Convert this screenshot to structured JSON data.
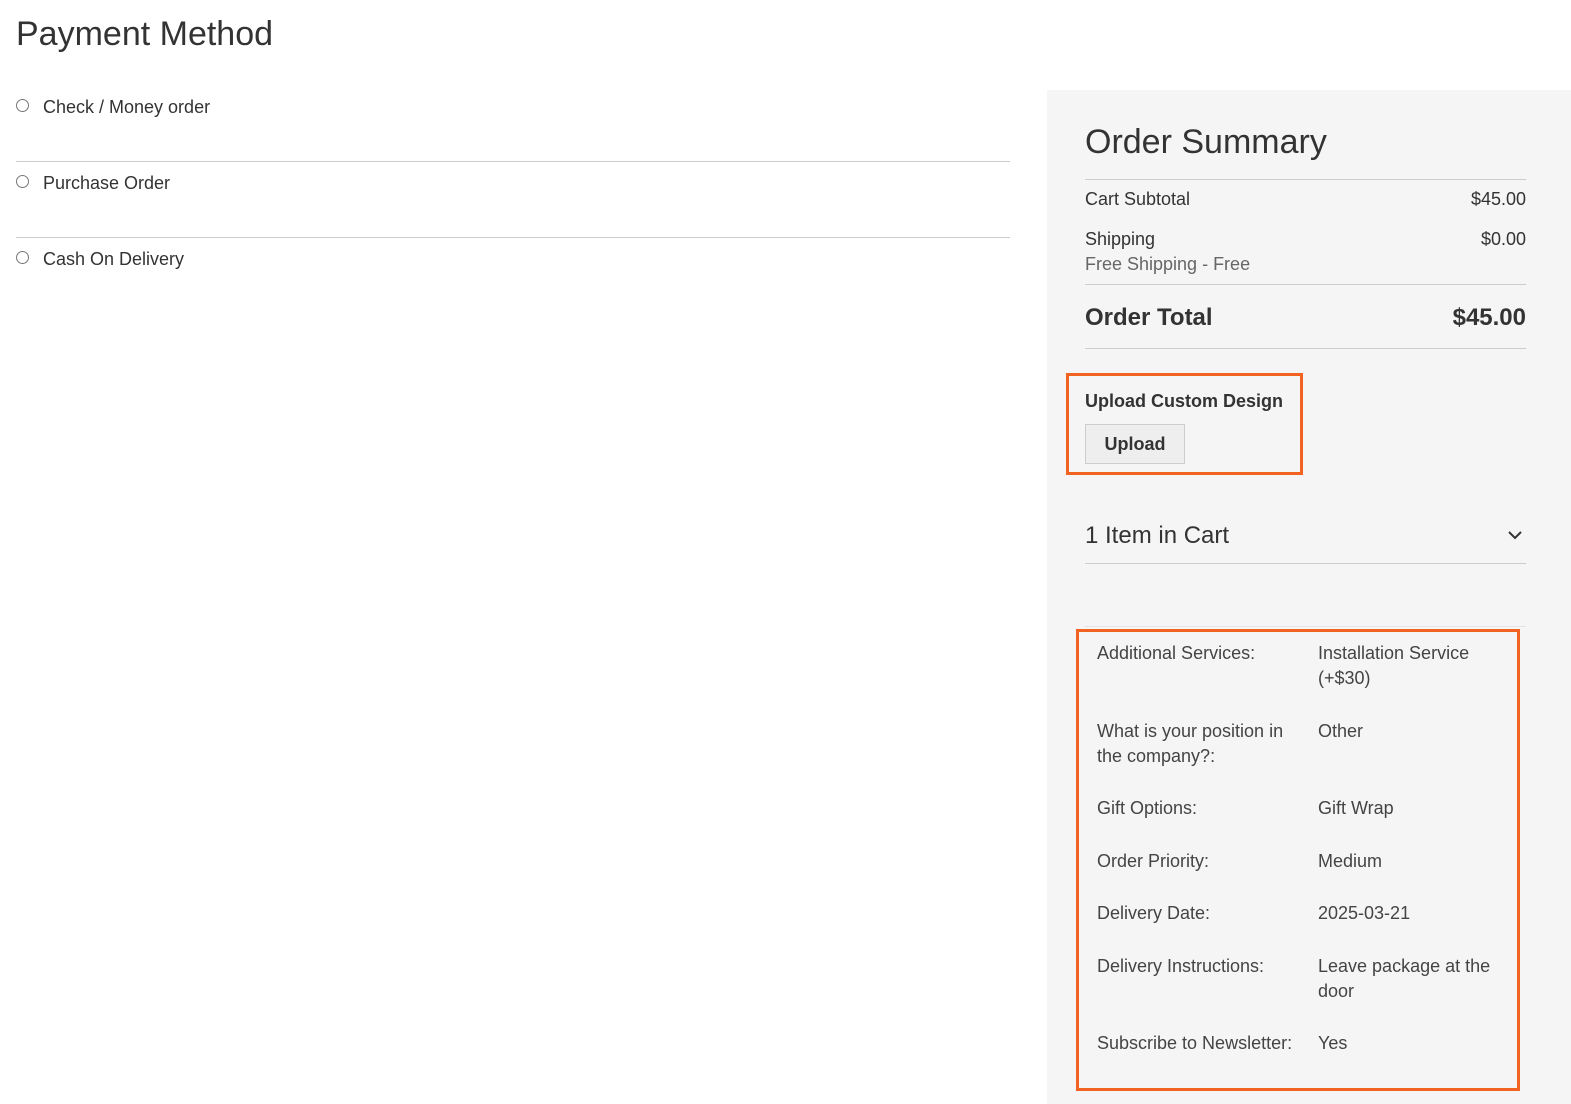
{
  "payment": {
    "title": "Payment Method",
    "options": [
      {
        "label": "Check / Money order"
      },
      {
        "label": "Purchase Order"
      },
      {
        "label": "Cash On Delivery"
      }
    ]
  },
  "summary": {
    "title": "Order Summary",
    "cart_subtotal_label": "Cart Subtotal",
    "cart_subtotal_value": "$45.00",
    "shipping_label": "Shipping",
    "shipping_value": "$0.00",
    "shipping_method": "Free Shipping - Free",
    "order_total_label": "Order Total",
    "order_total_value": "$45.00",
    "upload": {
      "label": "Upload Custom Design",
      "button": "Upload"
    },
    "cart_toggle_label": "1 Item in Cart",
    "details": [
      {
        "key": "Additional Services:",
        "value": "Installation Service (+$30)"
      },
      {
        "key": "What is your position in the company?:",
        "value": "Other"
      },
      {
        "key": "Gift Options:",
        "value": "Gift Wrap"
      },
      {
        "key": "Order Priority:",
        "value": "Medium"
      },
      {
        "key": "Delivery Date:",
        "value": "2025-03-21"
      },
      {
        "key": "Delivery Instructions:",
        "value": "Leave package at the door"
      },
      {
        "key": "Subscribe to Newsletter:",
        "value": "Yes"
      }
    ]
  },
  "colors": {
    "highlight": "#f26322",
    "panel_bg": "#f5f5f5"
  },
  "icons": {
    "cart_toggle": "chevron-down-icon"
  }
}
